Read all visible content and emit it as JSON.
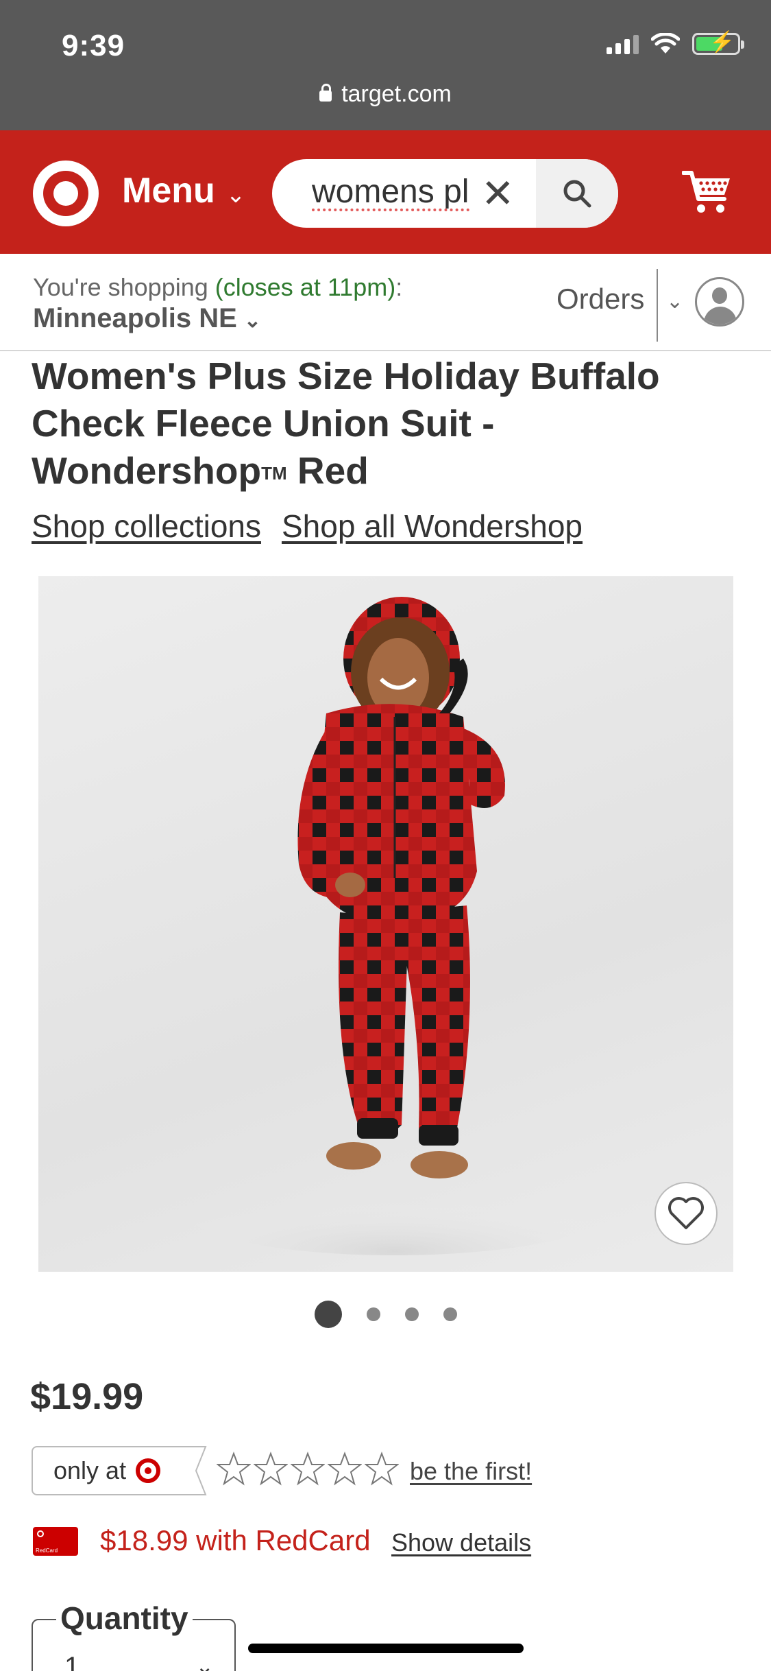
{
  "status_bar": {
    "time": "9:39"
  },
  "browser": {
    "url": "target.com"
  },
  "header": {
    "menu_label": "Menu",
    "search_value": "womens pl"
  },
  "location": {
    "prefix": "You're shopping ",
    "hours": "(closes at 11pm)",
    "suffix": ":",
    "store": "Minneapolis NE",
    "orders_label": "Orders"
  },
  "product": {
    "title_line1": "Women's Plus Size Holiday Buffalo",
    "title_line2": "Check Fleece Union Suit -",
    "title_line3_a": "Wondershop",
    "title_tm": "TM",
    "title_line3_b": " Red",
    "link_collections": "Shop collections",
    "link_brand": "Shop all Wondershop",
    "image_count": 4,
    "active_image": 1,
    "price": "$19.99",
    "only_at": "only at",
    "rating_stars": 5,
    "rating_value": 0,
    "review_prompt": "be the first!",
    "redcard_price": "$18.99 with RedCard",
    "redcard_card_text": "RedCard",
    "show_details": "Show details",
    "quantity_label": "Quantity",
    "quantity_value": "1"
  },
  "colors": {
    "brand_red": "#c4221b",
    "status_bar": "#595959",
    "plaid_red": "#c8201f",
    "plaid_black": "#1a1a1a",
    "hours_green": "#2f7a2f"
  }
}
